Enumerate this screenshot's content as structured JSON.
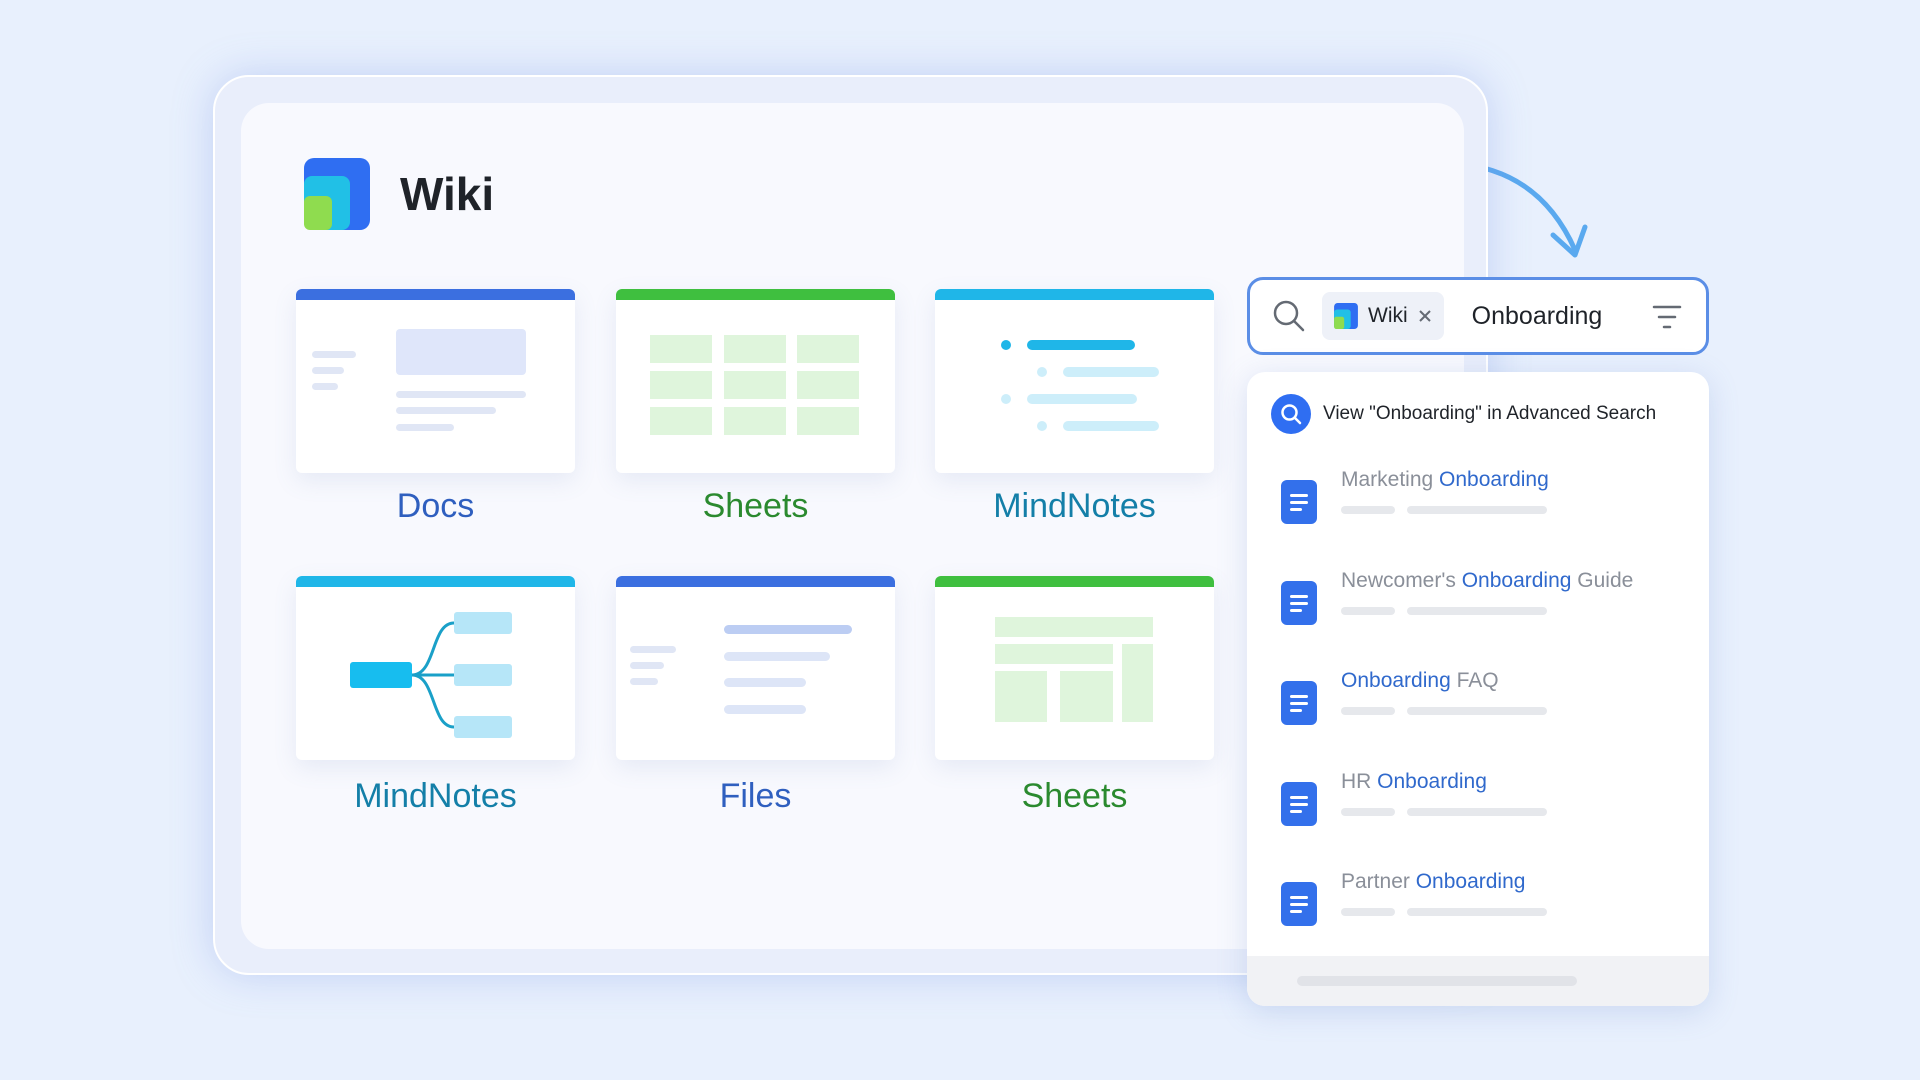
{
  "wiki": {
    "title": "Wiki"
  },
  "cards": [
    {
      "label": "Docs",
      "color": "#3b6fe0",
      "label_color": "#2f5fbf"
    },
    {
      "label": "Sheets",
      "color": "#3fbf3f",
      "label_color": "#2b8a2f"
    },
    {
      "label": "MindNotes",
      "color": "#1fb6e8",
      "label_color": "#147fa8"
    },
    {
      "label": "MindNotes",
      "color": "#1fb6e8",
      "label_color": "#147fa8"
    },
    {
      "label": "Files",
      "color": "#3b6fe0",
      "label_color": "#2f5fbf"
    },
    {
      "label": "Sheets",
      "color": "#3fbf3f",
      "label_color": "#2b8a2f"
    }
  ],
  "search": {
    "chip_label": "Wiki",
    "query": "Onboarding",
    "advanced_label": "View \"Onboarding\" in Advanced Search"
  },
  "results": [
    {
      "before": "Marketing ",
      "match": "Onboarding",
      "after": ""
    },
    {
      "before": "Newcomer's ",
      "match": "Onboarding",
      "after": " Guide"
    },
    {
      "before": "",
      "match": "Onboarding",
      "after": " FAQ"
    },
    {
      "before": "HR ",
      "match": "Onboarding",
      "after": ""
    },
    {
      "before": "Partner ",
      "match": "Onboarding",
      "after": ""
    }
  ],
  "colors": {
    "accent": "#3370eb",
    "highlight": "#3069cc",
    "background": "#e8f0fd"
  }
}
